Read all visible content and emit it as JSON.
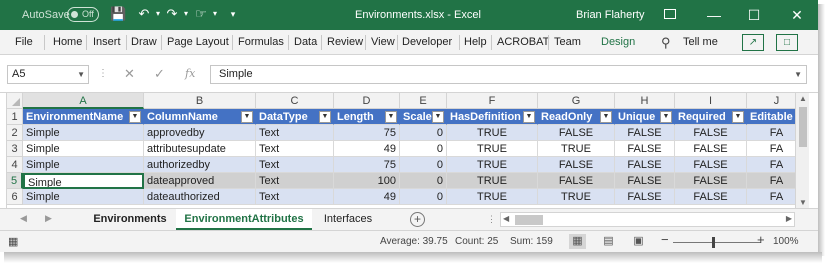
{
  "titlebar": {
    "autosave_label": "AutoSave",
    "autosave_state": "Off",
    "title": "Environments.xlsx  -  Excel",
    "user": "Brian Flaherty"
  },
  "ribbon": {
    "tabs": [
      "File",
      "Home",
      "Insert",
      "Draw",
      "Page Layout",
      "Formulas",
      "Data",
      "Review",
      "View",
      "Developer",
      "Help",
      "ACROBAT",
      "Team"
    ],
    "contextual_tab": "Design",
    "tell_me": "Tell me"
  },
  "formula_bar": {
    "name_box": "A5",
    "fx": "fx",
    "value": "Simple"
  },
  "grid": {
    "columns": [
      "A",
      "B",
      "C",
      "D",
      "E",
      "F",
      "G",
      "H",
      "I",
      "J"
    ],
    "rows": [
      "1",
      "2",
      "3",
      "4",
      "5",
      "6"
    ],
    "header_row": [
      "EnvironmentName",
      "ColumnName",
      "DataType",
      "Length",
      "Scale",
      "HasDefinition",
      "ReadOnly",
      "Unique",
      "Required",
      "Editable"
    ],
    "data_rows": [
      [
        "Simple",
        "approvedby",
        "Text",
        "75",
        "0",
        "TRUE",
        "FALSE",
        "FALSE",
        "FALSE",
        "FA"
      ],
      [
        "Simple",
        "attributesupdate",
        "Text",
        "49",
        "0",
        "TRUE",
        "TRUE",
        "FALSE",
        "FALSE",
        "FA"
      ],
      [
        "Simple",
        "authorizedby",
        "Text",
        "75",
        "0",
        "TRUE",
        "FALSE",
        "FALSE",
        "FALSE",
        "FA"
      ],
      [
        "Simple",
        "dateapproved",
        "Text",
        "100",
        "0",
        "TRUE",
        "FALSE",
        "FALSE",
        "FALSE",
        "FA"
      ],
      [
        "Simple",
        "dateauthorized",
        "Text",
        "49",
        "0",
        "TRUE",
        "TRUE",
        "FALSE",
        "FALSE",
        "FA"
      ]
    ],
    "active_cell": "A5"
  },
  "sheets": {
    "tabs": [
      "Environments",
      "EnvironmentAttributes",
      "Interfaces"
    ],
    "active": "EnvironmentAttributes"
  },
  "statusbar": {
    "average": "Average: 39.75",
    "count": "Count: 25",
    "sum": "Sum: 159",
    "zoom": "100%"
  },
  "colors": {
    "excel_green": "#217346",
    "table_header": "#4472c4",
    "table_band": "#d9e1f2"
  }
}
